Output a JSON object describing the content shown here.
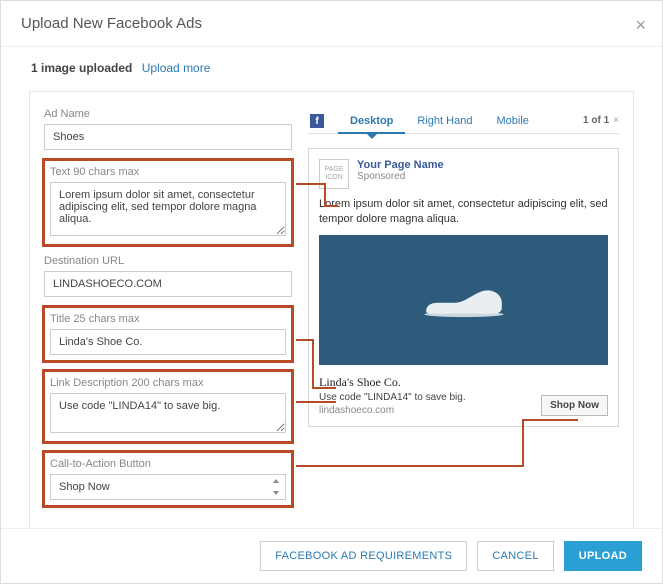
{
  "modal": {
    "title": "Upload New Facebook Ads"
  },
  "upload_status": {
    "count_text": "1 image uploaded",
    "more_link": "Upload more"
  },
  "fields": {
    "ad_name": {
      "label": "Ad Name",
      "value": "Shoes"
    },
    "text": {
      "label": "Text 90 chars max",
      "value": "Lorem ipsum dolor sit amet, consectetur adipiscing elit, sed tempor dolore magna aliqua."
    },
    "destination_url": {
      "label": "Destination URL",
      "value": "LINDASHOECO.COM"
    },
    "title": {
      "label": "Title 25 chars max",
      "value": "Linda's Shoe Co."
    },
    "link_desc": {
      "label": "Link Description 200 chars max",
      "value": "Use code \"LINDA14\" to save big."
    },
    "cta": {
      "label": "Call-to-Action Button",
      "value": "Shop Now"
    }
  },
  "preview": {
    "tabs": {
      "desktop": "Desktop",
      "right_hand": "Right Hand",
      "mobile": "Mobile"
    },
    "counter": "1 of 1",
    "page_icon_text": "PAGE\nICON",
    "page_name": "Your Page Name",
    "sponsored": "Sponsored",
    "ad_text": "Lorem ipsum dolor sit amet, consectetur adipiscing elit, sed tempor dolore magna aliqua.",
    "ad_title": "Linda's Shoe Co.",
    "ad_desc": "Use code \"LINDA14\" to save big.",
    "ad_domain": "lindashoeco.com",
    "cta_label": "Shop Now"
  },
  "footer": {
    "requirements": "FACEBOOK AD REQUIREMENTS",
    "cancel": "CANCEL",
    "upload": "UPLOAD"
  }
}
